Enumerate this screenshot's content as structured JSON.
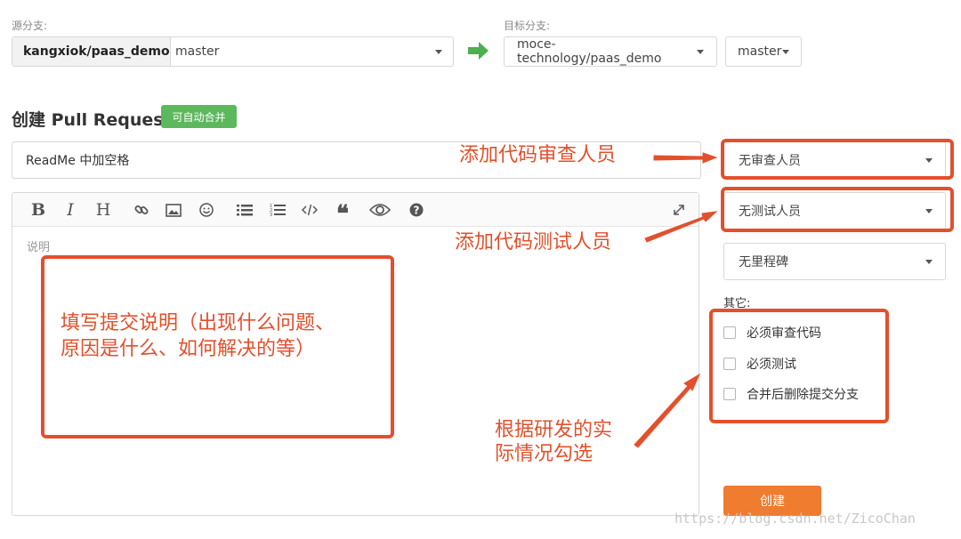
{
  "source": {
    "label": "源分支:",
    "repo": "kangxiok/paas_demo",
    "branch": "master"
  },
  "target": {
    "label": "目标分支:",
    "repo": "moce-technology/paas_demo",
    "branch": "master"
  },
  "header": {
    "title": "创建 Pull Request",
    "badge": "可自动合并"
  },
  "pr_title_value": "ReadMe 中加空格",
  "editor": {
    "toolbar": [
      "bold-icon",
      "italic-icon",
      "heading-icon",
      "link-icon",
      "image-icon",
      "emoji-icon",
      "bulleted-list-icon",
      "numbered-list-icon",
      "code-icon",
      "quote-icon",
      "preview-icon",
      "help-icon",
      "fullscreen-icon"
    ],
    "placeholder": "说明"
  },
  "sidebar": {
    "reviewers": "无审查人员",
    "testers": "无测试人员",
    "milestone": "无里程碑",
    "others_label": "其它:",
    "options": [
      {
        "label": "必须审查代码",
        "checked": false
      },
      {
        "label": "必须测试",
        "checked": false
      },
      {
        "label": "合并后删除提交分支",
        "checked": false
      }
    ],
    "create_button": "创建"
  },
  "annotations": {
    "reviewers": "添加代码审查人员",
    "testers": "添加代码测试人员",
    "description_line1": "填写提交说明（出现什么问题、",
    "description_line2": "原因是什么、如何解决的等）",
    "options_line1": "根据研发的实",
    "options_line2": "际情况勾选",
    "color": "#e2502c"
  },
  "watermark": "https://blog.csdn.net/ZicoChan",
  "colors": {
    "badge": "#5cb85c",
    "arrow": "#4caf50",
    "create_button": "#f07c2f"
  }
}
